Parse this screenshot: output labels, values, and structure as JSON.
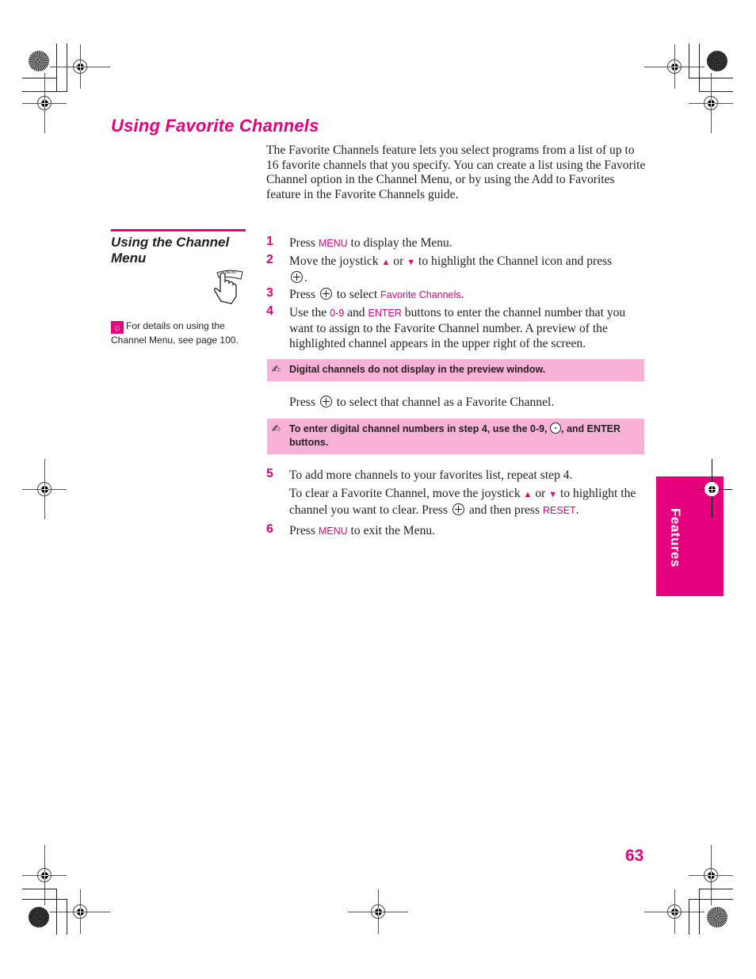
{
  "page": {
    "title": "Using Favorite Channels",
    "intro": "The Favorite Channels feature lets you select programs from a list of up to 16 favorite channels that you specify. You can create a list using the Favorite Channel option in the Channel Menu, or by using the Add to Favorites feature in the Favorite Channels guide.",
    "section_heading": "Using the Channel Menu",
    "illustration_label": "MENU",
    "tip": "For details on using the Channel Menu, see page 100.",
    "tip_icon": "lightbulb-icon",
    "accent_color": "#e5007e",
    "note_bg_color": "#f8b2d8",
    "side_tab": "Features",
    "page_number": "63"
  },
  "steps": [
    {
      "num": "1",
      "pre": "Press ",
      "kw": "MENU",
      "post": " to display the Menu."
    },
    {
      "num": "2",
      "pre": "Move the joystick ",
      "up": "▲",
      "mid": " or ",
      "down": "▼",
      "post": " to highlight the Channel icon and press",
      "end": "."
    },
    {
      "num": "3",
      "pre": "Press ",
      "mid": " to select ",
      "kw": "Favorite Channels",
      "end": "."
    },
    {
      "num": "4",
      "pre": "Use the ",
      "kw1": "0-9",
      "mid": " and ",
      "kw2": "ENTER",
      "post": " buttons to enter the channel number that you want to assign to the Favorite Channel number. A preview of the highlighted channel appears in the upper right of the screen."
    },
    {
      "num": "5",
      "text": "To add more channels to your favorites list, repeat step 4."
    },
    {
      "num": "6",
      "pre": "Press ",
      "kw": "MENU",
      "post": " to exit the Menu."
    }
  ],
  "step4_continue": {
    "pre": "Press ",
    "post": " to select that channel as a Favorite Channel."
  },
  "step5_continue": {
    "pre": "To clear a Favorite Channel, move the joystick ",
    "up": "▲",
    "mid": " or ",
    "down": "▼",
    "post": " to highlight the channel you want to clear. Press ",
    "post2": " and then press ",
    "kw": "RESET",
    "end": "."
  },
  "notes": [
    {
      "icon": "✍",
      "text": "Digital channels do not display in the preview window."
    },
    {
      "icon": "✍",
      "pre": "To enter digital channel numbers in step 4, use the 0-9, ",
      "post": ", and ENTER buttons."
    }
  ]
}
